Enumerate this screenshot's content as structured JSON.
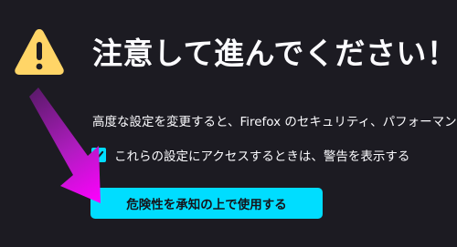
{
  "page": {
    "title": "注意して進んでください！",
    "description": "高度な設定を変更すると、Firefox のセキュリティ、パフォーマンス"
  },
  "checkbox": {
    "label": "これらの設定にアクセスするときは、警告を表示する",
    "checked": true
  },
  "button": {
    "label": "危険性を承知の上で使用する"
  },
  "icons": {
    "warning": "warning-triangle-icon",
    "checkmark": "checkmark-icon",
    "annotation": "pointer-arrow"
  },
  "colors": {
    "background": "#1c1b22",
    "accent": "#00ddff",
    "warning": "#ffd567",
    "annotation": "#e020e0"
  }
}
